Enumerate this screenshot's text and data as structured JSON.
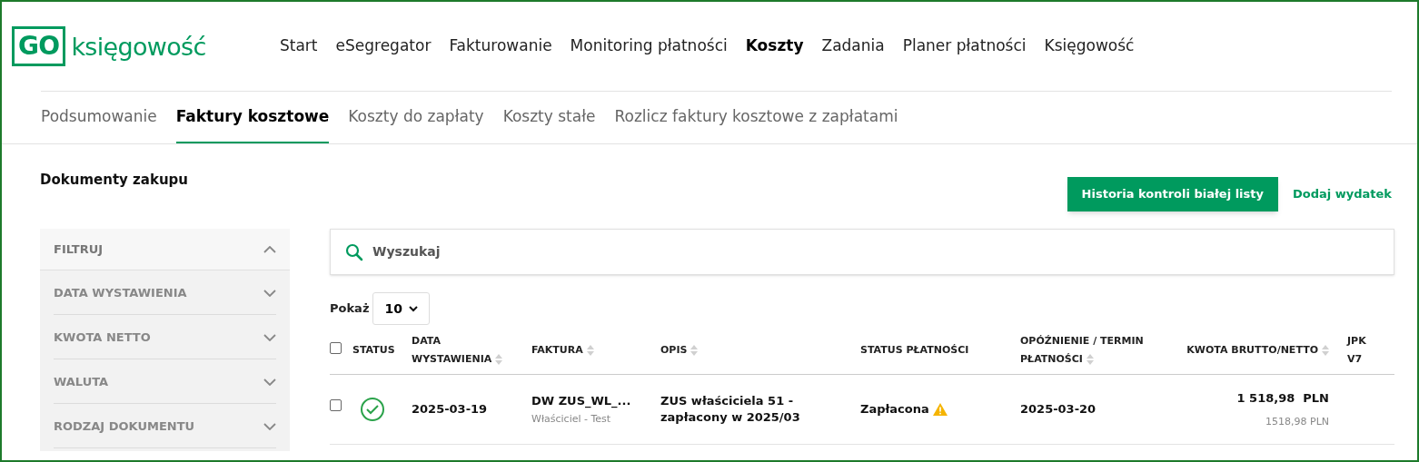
{
  "logo": {
    "mark": "GO",
    "text": "księgowość"
  },
  "nav": [
    {
      "label": "Start",
      "selected": false
    },
    {
      "label": "eSegregator",
      "selected": false
    },
    {
      "label": "Fakturowanie",
      "selected": false
    },
    {
      "label": "Monitoring płatności",
      "selected": false
    },
    {
      "label": "Koszty",
      "selected": true
    },
    {
      "label": "Zadania",
      "selected": false
    },
    {
      "label": "Planer płatności",
      "selected": false
    },
    {
      "label": "Księgowość",
      "selected": false
    }
  ],
  "subtabs": [
    {
      "label": "Podsumowanie",
      "selected": false
    },
    {
      "label": "Faktury kosztowe",
      "selected": true
    },
    {
      "label": "Koszty do zapłaty",
      "selected": false
    },
    {
      "label": "Koszty stałe",
      "selected": false
    },
    {
      "label": "Rozlicz faktury kosztowe z zapłatami",
      "selected": false
    }
  ],
  "page_title": "Dokumenty zakupu",
  "actions": {
    "primary": "Historia kontroli białej listy",
    "link": "Dodaj wydatek"
  },
  "filters": {
    "title": "FILTRUJ",
    "expanded": true,
    "items": [
      {
        "label": "DATA WYSTAWIENIA",
        "expanded": false
      },
      {
        "label": "KWOTA NETTO",
        "expanded": false
      },
      {
        "label": "WALUTA",
        "expanded": false
      },
      {
        "label": "RODZAJ DOKUMENTU",
        "expanded": false
      }
    ]
  },
  "search": {
    "placeholder": "Wyszukaj"
  },
  "page_size": {
    "label": "Pokaż",
    "value": "10"
  },
  "table": {
    "select_all": {
      "checked": false
    },
    "columns": [
      {
        "label": "STATUS",
        "sortable": false
      },
      {
        "label": "DATA WYSTAWIENIA",
        "sortable": true
      },
      {
        "label": "FAKTURA",
        "sortable": true
      },
      {
        "label": "OPIS",
        "sortable": true
      },
      {
        "label": "STATUS PŁATNOŚCI",
        "sortable": false
      },
      {
        "label": "OPÓŹNIENIE / TERMIN PŁATNOŚCI",
        "sortable": true
      },
      {
        "label": "KWOTA BRUTTO/NETTO",
        "sortable": true
      },
      {
        "label": "JPK V7",
        "sortable": false
      }
    ],
    "rows": [
      {
        "checked": false,
        "status_ok": true,
        "date": "2025-03-19",
        "invoice": "DW ZUS_WL_...",
        "invoice_sub": "Właściciel - Test",
        "description": "ZUS właściciela 51 - zapłacony w 2025/03",
        "payment_status": "Zapłacona",
        "payment_warning": true,
        "due": "2025-03-20",
        "gross": "1 518,98  PLN",
        "net": "1518,98 PLN"
      }
    ]
  }
}
